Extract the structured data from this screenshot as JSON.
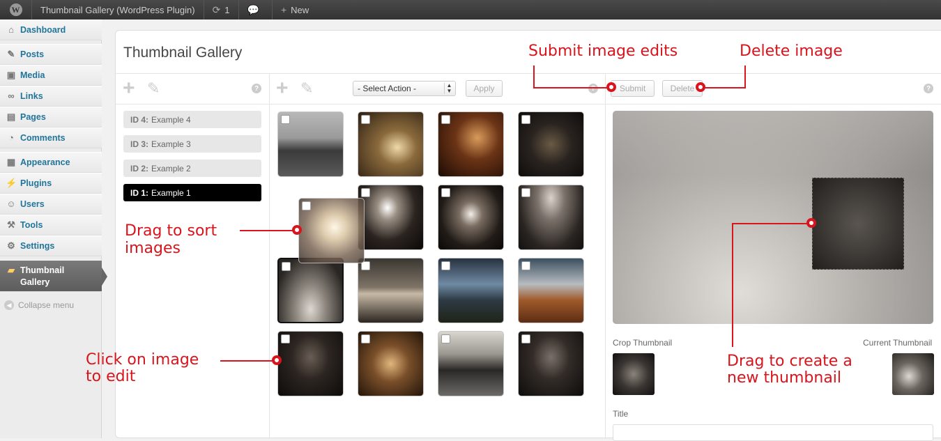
{
  "admin_bar": {
    "site_name": "Thumbnail Gallery (WordPress Plugin)",
    "updates_count": "1",
    "new_label": "New"
  },
  "sidebar": {
    "items": [
      {
        "label": "Dashboard",
        "icon": "home-icon"
      },
      {
        "label": "Posts",
        "icon": "pin-icon"
      },
      {
        "label": "Media",
        "icon": "media-icon"
      },
      {
        "label": "Links",
        "icon": "link-icon"
      },
      {
        "label": "Pages",
        "icon": "page-icon"
      },
      {
        "label": "Comments",
        "icon": "comment-icon"
      },
      {
        "label": "Appearance",
        "icon": "appearance-icon"
      },
      {
        "label": "Plugins",
        "icon": "plugin-icon"
      },
      {
        "label": "Users",
        "icon": "users-icon"
      },
      {
        "label": "Tools",
        "icon": "tools-icon"
      },
      {
        "label": "Settings",
        "icon": "settings-icon"
      }
    ],
    "current": {
      "line1": "Thumbnail",
      "line2": "Gallery"
    },
    "collapse_label": "Collapse menu"
  },
  "page": {
    "title": "Thumbnail Gallery"
  },
  "galleries": [
    {
      "id": "ID 4:",
      "name": "Example 4",
      "active": false
    },
    {
      "id": "ID 3:",
      "name": "Example 3",
      "active": false
    },
    {
      "id": "ID 2:",
      "name": "Example 2",
      "active": false
    },
    {
      "id": "ID 1:",
      "name": "Example 1",
      "active": true
    }
  ],
  "toolbar": {
    "select_action": "- Select Action -",
    "apply_label": "Apply",
    "submit_label": "Submit",
    "delete_label": "Delete"
  },
  "editor": {
    "crop_label": "Crop Thumbnail",
    "current_label": "Current Thumbnail",
    "title_label": "Title"
  },
  "annotations": {
    "submit": "Submit image edits",
    "delete": "Delete image",
    "sort_1": "Drag to sort",
    "sort_2": "images",
    "click_1": "Click on image",
    "click_2": "to edit",
    "crop_1": "Drag to create a",
    "crop_2": "new thumbnail"
  },
  "colors": {
    "annotation": "#d8141c",
    "link": "#21759b"
  }
}
